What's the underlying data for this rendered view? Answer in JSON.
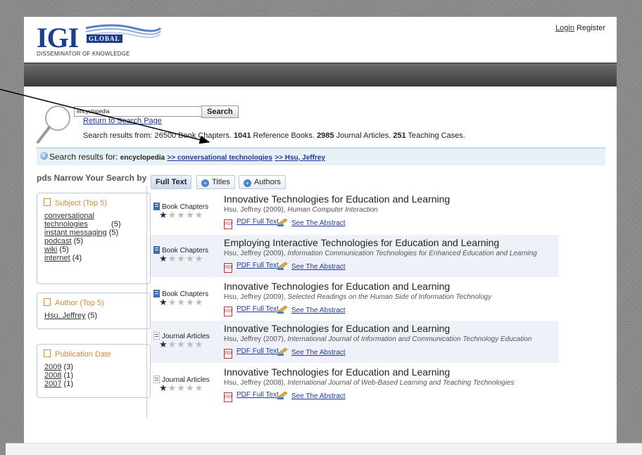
{
  "header": {
    "logo": {
      "mark": "IGI",
      "global": "GLOBAL",
      "tagline": "DISSEMINATOR OF KNOWLEDGE"
    },
    "login_label": "Login",
    "register_label": "Register"
  },
  "search": {
    "input_value": "encyclopedia",
    "button_label": "Search",
    "return_link": "Return to Search Page",
    "summary": {
      "prefix": "Search results from: ",
      "chapters_count": "26500",
      "chapters_label": " Book Chapters. ",
      "reference_count": "1041",
      "reference_label": " Reference Books. ",
      "journal_count": "2985",
      "journal_label": " Journal Articles. ",
      "cases_count": "251",
      "cases_label": " Teaching Cases."
    }
  },
  "breadcrumb": {
    "label": "Search results for: ",
    "term": "encyclopedia",
    "links": [
      ">> conversational technologies",
      ">> Hsu, Jeffrey"
    ]
  },
  "sidebar": {
    "title": "pds Narrow Your Search by",
    "facets": [
      {
        "header": "Subject (Top 5)",
        "items": [
          {
            "label": "conversational technologies",
            "count": " (5)"
          },
          {
            "label": "instant messaging",
            "count": " (5)"
          },
          {
            "label": "podcast",
            "count": " (5)"
          },
          {
            "label": "wiki",
            "count": " (5)"
          },
          {
            "label": "internet",
            "count": " (4)"
          }
        ]
      },
      {
        "header": "Author (Top 5)",
        "items": [
          {
            "label": "Hsu, Jeffrey",
            "count": " (5)"
          }
        ]
      },
      {
        "header": "Publication Date",
        "items": [
          {
            "label": "2009",
            "count": " (3)"
          },
          {
            "label": "2008",
            "count": " (1)"
          },
          {
            "label": "2007",
            "count": " (1)"
          }
        ]
      }
    ]
  },
  "tabs": [
    {
      "label": "Full Text",
      "active": true
    },
    {
      "label": "Titles",
      "active": false
    },
    {
      "label": "Authors",
      "active": false
    }
  ],
  "results": [
    {
      "type": "Book Chapters",
      "title": "Innovative Technologies for Education and Learning",
      "author": "Hsu, Jeffrey (2009), ",
      "source": "Human Computer Interaction",
      "pdf": "PDF Full Text",
      "abstract": "See The Abstract",
      "rating": 1
    },
    {
      "type": "Book Chapters",
      "title": "Employing Interactive Technologies for Education and Learning",
      "author": "Hsu, Jeffrey (2009), ",
      "source": "Information Communication Technologies for Enhanced Education and Learning",
      "pdf": "PDF Full Text",
      "abstract": "See The Abstract",
      "rating": 1
    },
    {
      "type": "Book Chapters",
      "title": "Innovative Technologies for Education and Learning",
      "author": "Hsu, Jeffrey (2009), ",
      "source": "Selected Readings on the Human Side of Information Technology",
      "pdf": "PDF Full Text",
      "abstract": "See The Abstract",
      "rating": 1
    },
    {
      "type": "Journal Articles",
      "title": "Innovative Technologies for Education and Learning",
      "author": "Hsu, Jeffrey (2007), ",
      "source": "International Journal of Information and Communication Technology Education",
      "pdf": "PDF Full Text",
      "abstract": "See The Abstract",
      "rating": 1
    },
    {
      "type": "Journal Articles",
      "title": "Innovative Technologies for Education and Learning",
      "author": "Hsu, Jeffrey (2008), ",
      "source": "International Journal of Web-Based Learning and Teaching Technologies",
      "pdf": "PDF Full Text",
      "abstract": "See The Abstract",
      "rating": 1
    }
  ],
  "colors": {
    "brand_blue": "#1d3e8c",
    "link": "#1f3a9c",
    "facet_header": "#d9873a",
    "pdf_red": "#cc3333"
  }
}
